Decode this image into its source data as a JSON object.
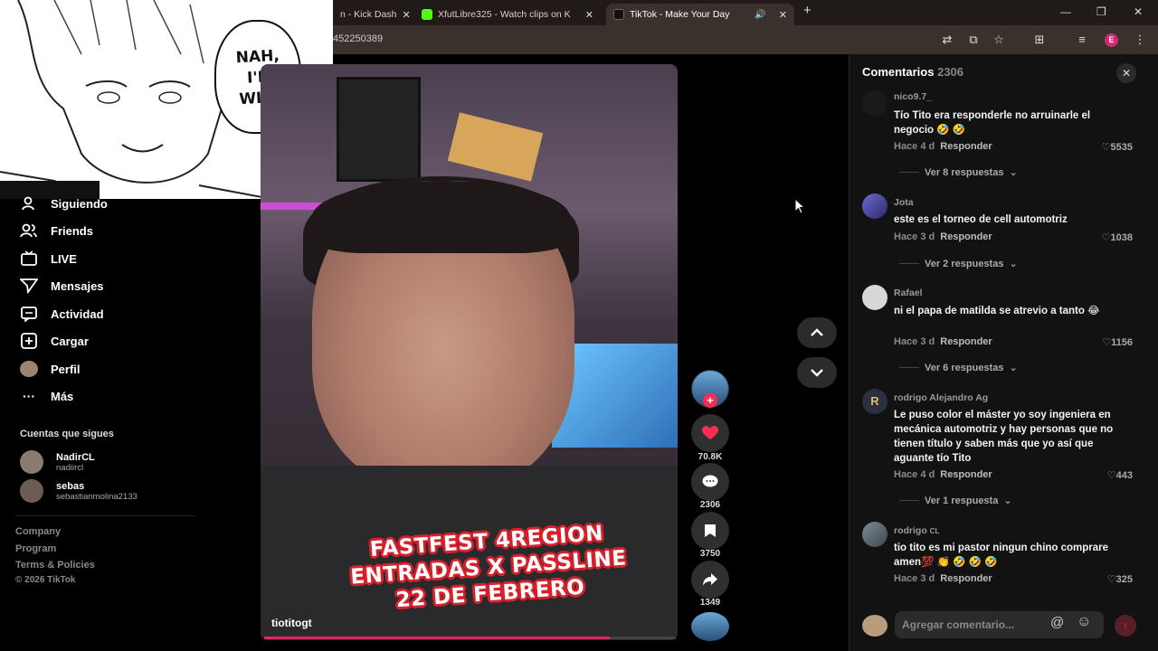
{
  "browser": {
    "tabs": [
      {
        "label": "n - Kick Dash",
        "favicon_color": "#53fc18"
      },
      {
        "label": "XfutLibre325 - Watch clips on K",
        "favicon_color": "#53fc18"
      },
      {
        "label": "TikTok - Make Your Day",
        "favicon_color": "#111111"
      }
    ],
    "new_tab": "+",
    "url": "452250389",
    "window_controls": [
      "—",
      "❐",
      "✕"
    ]
  },
  "manga": {
    "speech": [
      "NAH,",
      "I'D",
      "WIN."
    ]
  },
  "sidebar": {
    "nav": [
      {
        "label": "Siguiendo",
        "icon": "following-icon"
      },
      {
        "label": "Friends",
        "icon": "friends-icon"
      },
      {
        "label": "LIVE",
        "icon": "live-icon"
      },
      {
        "label": "Mensajes",
        "icon": "messages-icon"
      },
      {
        "label": "Actividad",
        "icon": "activity-icon"
      },
      {
        "label": "Cargar",
        "icon": "upload-icon"
      },
      {
        "label": "Perfil",
        "icon": "profile-icon"
      },
      {
        "label": "Más",
        "icon": "more-icon"
      }
    ],
    "following_heading": "Cuentas que sigues",
    "accounts": [
      {
        "name": "NadirCL",
        "handle": "nadiircl"
      },
      {
        "name": "sebas",
        "handle": "sebastianmolina2133"
      }
    ],
    "footer": [
      "Company",
      "Program",
      "Terms & Policies",
      "© 2026 TikTok"
    ]
  },
  "video": {
    "caption": [
      "FASTFEST 4REGION",
      "ENTRADAS X PASSLINE",
      "22 DE FEBRERO"
    ],
    "author": "tiotitogt",
    "progress": 0.84
  },
  "actions": {
    "likes": "70.8K",
    "comments": "2306",
    "saves": "3750",
    "shares": "1349"
  },
  "comments_panel": {
    "title": "Comentarios",
    "count": "2306",
    "input_placeholder": "Agregar comentario...",
    "reply_label": "Responder",
    "items": [
      {
        "user": "nico9.7_",
        "text": "Tío Tito era responderle no arruinarle el negocio 🤣 🤣",
        "time": "Hace 4 d",
        "likes": "5535",
        "replies": "Ver 8 respuestas"
      },
      {
        "user": "Jota",
        "text": "este es el torneo de cell automotriz",
        "time": "Hace 3 d",
        "likes": "1038",
        "replies": "Ver 2 respuestas"
      },
      {
        "user": "Rafael",
        "text": "ni el papa de matilda se atrevio a tanto 😂",
        "time": "Hace 3 d",
        "likes": "1156",
        "replies": "Ver 6 respuestas"
      },
      {
        "user": "rodrigo Alejandro Ag",
        "text": "Le puso color el máster yo soy ingeniera en mecánica automotriz y hay personas que no tienen título y saben más que yo así que aguante tío Tito",
        "time": "Hace 4 d",
        "likes": "443",
        "replies": "Ver 1 respuesta"
      },
      {
        "user": "rodrigo",
        "user_suffix": "CL",
        "text": "tio tito es mi pastor ningun chino comprare amen💯 👏 🤣 🤣 🤣",
        "time": "Hace 3 d",
        "likes": "325"
      }
    ]
  }
}
